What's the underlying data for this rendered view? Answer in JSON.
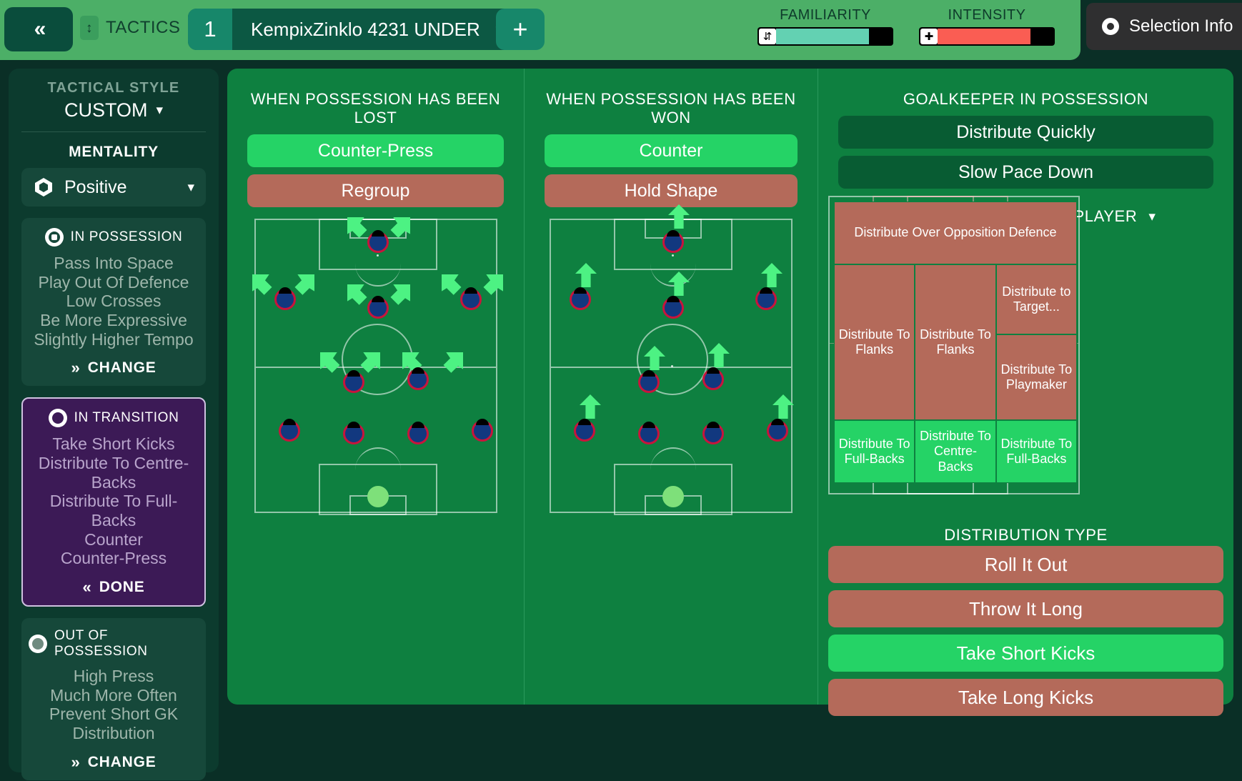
{
  "header": {
    "collapse_icon": "chevrons-left-icon",
    "tactics_label": "TACTICS",
    "tactic_number": "1",
    "tactic_name": "KempixZinklo 4231 UNDER",
    "add_label": "+",
    "familiarity": {
      "label": "FAMILIARITY",
      "fill_percent": 80,
      "color": "#63d1b2"
    },
    "intensity": {
      "label": "INTENSITY",
      "fill_percent": 80,
      "color": "#fa5d53"
    },
    "selection_info": "Selection Info"
  },
  "sidebar": {
    "tactical_style_label": "TACTICAL STYLE",
    "tactical_style_value": "CUSTOM",
    "mentality_label": "MENTALITY",
    "mentality_value": "Positive",
    "phases": [
      {
        "title": "IN POSSESSION",
        "items": [
          "Pass Into Space",
          "Play Out Of Defence",
          "Low Crosses",
          "Be More Expressive",
          "Slightly Higher Tempo"
        ],
        "action": "CHANGE",
        "active": false
      },
      {
        "title": "IN TRANSITION",
        "items": [
          "Take Short Kicks",
          "Distribute To Centre-Backs",
          "Distribute To Full-Backs",
          "Counter",
          "Counter-Press"
        ],
        "action": "DONE",
        "active": true
      },
      {
        "title": "OUT OF POSSESSION",
        "items": [
          "High Press",
          "Much More Often",
          "Prevent Short GK",
          "Distribution"
        ],
        "action": "CHANGE",
        "active": false
      }
    ]
  },
  "main": {
    "lost": {
      "title": "WHEN POSSESSION HAS BEEN LOST",
      "options": [
        {
          "label": "Counter-Press",
          "state": "selected"
        },
        {
          "label": "Regroup",
          "state": "unselected"
        }
      ]
    },
    "won": {
      "title": "WHEN POSSESSION HAS BEEN WON",
      "options": [
        {
          "label": "Counter",
          "state": "selected"
        },
        {
          "label": "Hold Shape",
          "state": "unselected"
        }
      ]
    },
    "gk": {
      "title": "GOALKEEPER IN POSSESSION",
      "options": [
        {
          "label": "Distribute Quickly",
          "state": "inactive"
        },
        {
          "label": "Slow Pace Down",
          "state": "inactive"
        }
      ],
      "distribute_area_title": "DISTRIBUTE TO AREA/PLAYER",
      "distribute_cells": [
        {
          "label": "Distribute Over Opposition Defence",
          "state": "unselected"
        },
        {
          "label": "",
          "state": "unselected"
        },
        {
          "label": "Distribute to Target...",
          "state": "unselected"
        },
        {
          "label": "",
          "state": "unselected"
        },
        {
          "label": "Distribute To Flanks",
          "state": "unselected"
        },
        {
          "label": "Distribute To Playmaker",
          "state": "unselected"
        },
        {
          "label": "Distribute To Flanks",
          "state": "unselected"
        },
        {
          "label": "Distribute To Full-Backs",
          "state": "selected"
        },
        {
          "label": "Distribute To Centre-Backs",
          "state": "selected"
        },
        {
          "label": "Distribute To Full-Backs",
          "state": "selected"
        }
      ],
      "distribution_type_title": "DISTRIBUTION TYPE",
      "distribution_types": [
        {
          "label": "Roll It Out",
          "state": "unselected"
        },
        {
          "label": "Throw It Long",
          "state": "unselected"
        },
        {
          "label": "Take Short Kicks",
          "state": "selected"
        },
        {
          "label": "Take Long Kicks",
          "state": "unselected"
        }
      ]
    }
  },
  "colors": {
    "selected_green": "#25d366",
    "unselected_red": "#b46a5a",
    "panel_green": "#0e8040",
    "background": "#0a2f26",
    "sidebar_card": "#16483a",
    "transition_purple": "#3c1a56"
  }
}
